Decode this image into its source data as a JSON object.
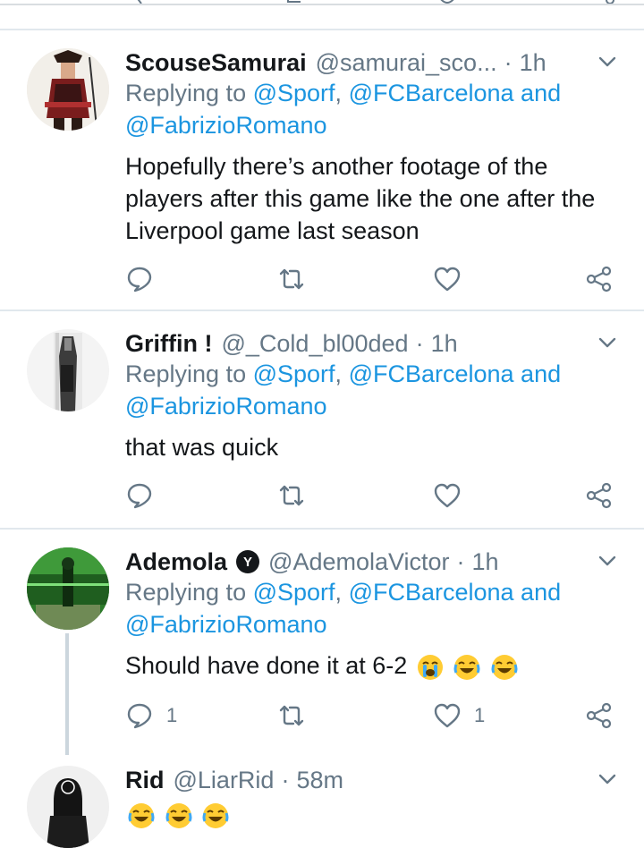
{
  "tweets": [
    {
      "name": "ScouseSamurai",
      "handle": "@samurai_sco...",
      "time": "1h",
      "replying_prefix": "Replying to ",
      "mentions": [
        "@Sporf",
        "@FCBarcelona",
        "@FabrizioRomano"
      ],
      "sep": ", ",
      "and": " and",
      "text": "Hopefully there’s another footage of the players after this game like the one after the Liverpool game last season",
      "reply_count": "",
      "like_count": ""
    },
    {
      "name": "Griffin !",
      "handle": "@_Cold_bl00ded",
      "time": "1h",
      "replying_prefix": "Replying to ",
      "mentions": [
        "@Sporf",
        "@FCBarcelona",
        "@FabrizioRomano"
      ],
      "sep": ", ",
      "and": " and",
      "text": "that was quick",
      "reply_count": "",
      "like_count": ""
    },
    {
      "name": "Ademola",
      "verified_letter": "Y",
      "handle": "@AdemolaVictor",
      "time": "1h",
      "replying_prefix": "Replying to ",
      "mentions": [
        "@Sporf",
        "@FCBarcelona",
        "@FabrizioRomano"
      ],
      "sep": ", ",
      "and": " and",
      "text": "Should have done it at 6-2",
      "reply_count": "1",
      "like_count": "1"
    },
    {
      "name": "Rid",
      "handle": "@LiarRid",
      "time": "58m",
      "text": ""
    }
  ],
  "separator": "·",
  "colors": {
    "link": "#1b95e0",
    "muted": "#657786",
    "divider": "#e1e8ed"
  }
}
